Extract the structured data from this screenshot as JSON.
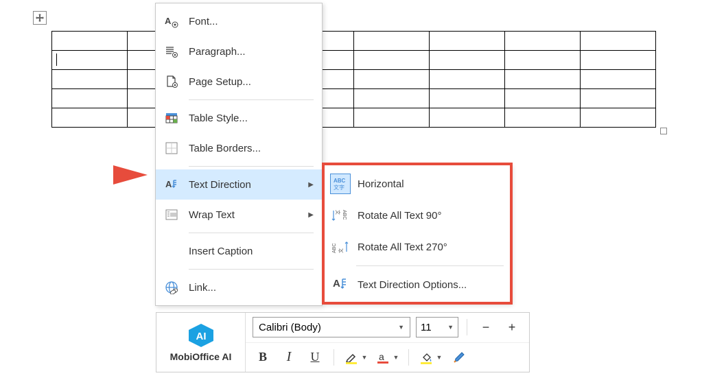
{
  "table": {
    "rows": 5,
    "cols": 8
  },
  "context_menu": {
    "items": [
      {
        "label": "Font...",
        "icon": "font-gear-icon",
        "has_submenu": false
      },
      {
        "label": "Paragraph...",
        "icon": "paragraph-gear-icon",
        "has_submenu": false
      },
      {
        "label": "Page Setup...",
        "icon": "page-gear-icon",
        "has_submenu": false
      },
      {
        "separator": true
      },
      {
        "label": "Table Style...",
        "icon": "table-style-icon",
        "has_submenu": false
      },
      {
        "label": "Table Borders...",
        "icon": "table-borders-icon",
        "has_submenu": false
      },
      {
        "separator": true
      },
      {
        "label": "Text Direction",
        "icon": "text-direction-icon",
        "has_submenu": true,
        "highlighted": true
      },
      {
        "label": "Wrap Text",
        "icon": "wrap-text-icon",
        "has_submenu": true
      },
      {
        "separator": true
      },
      {
        "label": "Insert Caption",
        "icon": null,
        "has_submenu": false
      },
      {
        "separator": true
      },
      {
        "label": "Link...",
        "icon": "link-icon",
        "has_submenu": false
      }
    ]
  },
  "submenu": {
    "items": [
      {
        "label": "Horizontal",
        "icon": "horizontal-text-icon",
        "selected": true
      },
      {
        "label": "Rotate All Text 90°",
        "icon": "rotate-90-icon"
      },
      {
        "label": "Rotate All Text 270°",
        "icon": "rotate-270-icon"
      },
      {
        "separator": true
      },
      {
        "label": "Text Direction Options...",
        "icon": "text-direction-options-icon"
      }
    ]
  },
  "toolbar": {
    "ai_label": "MobiOffice AI",
    "font_name": "Calibri (Body)",
    "font_size": "11",
    "buttons": {
      "bold": "B",
      "italic": "I",
      "underline": "U"
    }
  }
}
